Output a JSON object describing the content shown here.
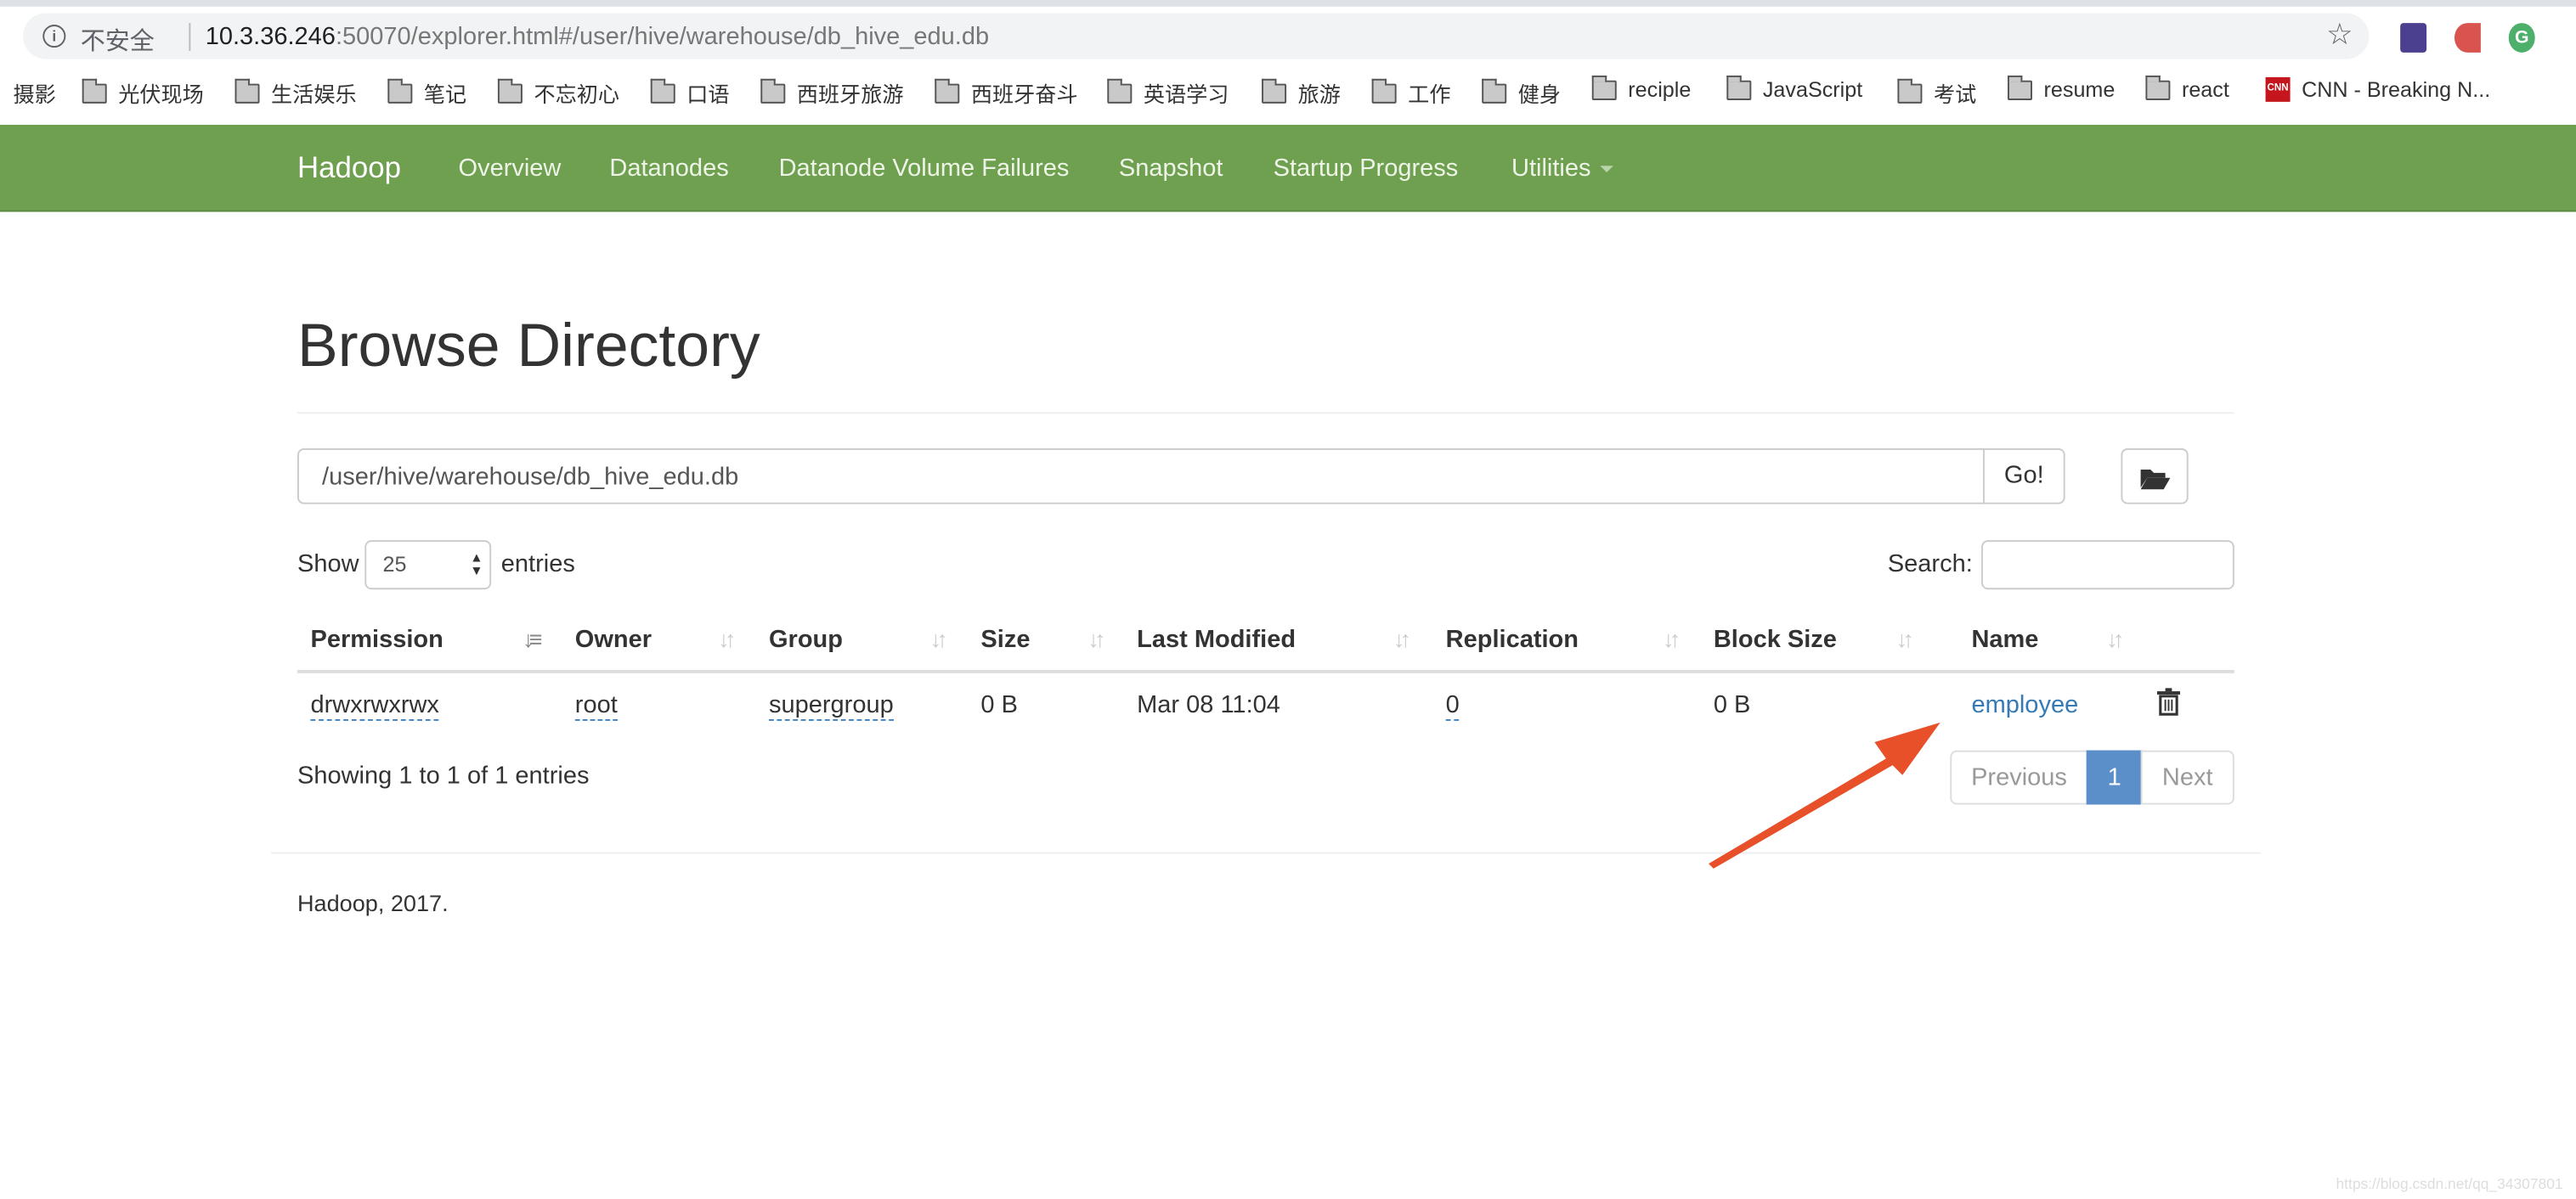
{
  "browser": {
    "security_label": "不安全",
    "url_host": "10.3.36.246",
    "url_rest": ":50070/explorer.html#/user/hive/warehouse/db_hive_edu.db",
    "bookmarks": [
      "摄影",
      "光伏现场",
      "生活娱乐",
      "笔记",
      "不忘初心",
      "口语",
      "西班牙旅游",
      "西班牙奋斗",
      "英语学习",
      "旅游",
      "工作",
      "健身",
      "reciple",
      "JavaScript",
      "考试",
      "resume",
      "react",
      "CNN - Breaking N..."
    ],
    "extension_colors": [
      "#4b3f8f",
      "#d9534f",
      "#4caf6a"
    ]
  },
  "navbar": {
    "brand": "Hadoop",
    "items": [
      "Overview",
      "Datanodes",
      "Datanode Volume Failures",
      "Snapshot",
      "Startup Progress",
      "Utilities"
    ],
    "color": "#6ea050"
  },
  "page": {
    "title": "Browse Directory",
    "path_value": "/user/hive/warehouse/db_hive_edu.db",
    "go_label": "Go!",
    "show_label": "Show",
    "entries_value": "25",
    "entries_label": "entries",
    "search_label": "Search:",
    "columns": [
      "Permission",
      "Owner",
      "Group",
      "Size",
      "Last Modified",
      "Replication",
      "Block Size",
      "Name"
    ],
    "rows": [
      {
        "permission": "drwxrwxrwx",
        "owner": "root",
        "group": "supergroup",
        "size": "0 B",
        "modified": "Mar 08 11:04",
        "replication": "0",
        "block_size": "0 B",
        "name": "employee"
      }
    ],
    "showing": "Showing 1 to 1 of 1 entries",
    "pagination": {
      "previous": "Previous",
      "current": "1",
      "next": "Next"
    },
    "footer": "Hadoop, 2017."
  },
  "annotation": {
    "arrow_color": "#e8502a"
  },
  "watermark": "https://blog.csdn.net/qq_34307801"
}
